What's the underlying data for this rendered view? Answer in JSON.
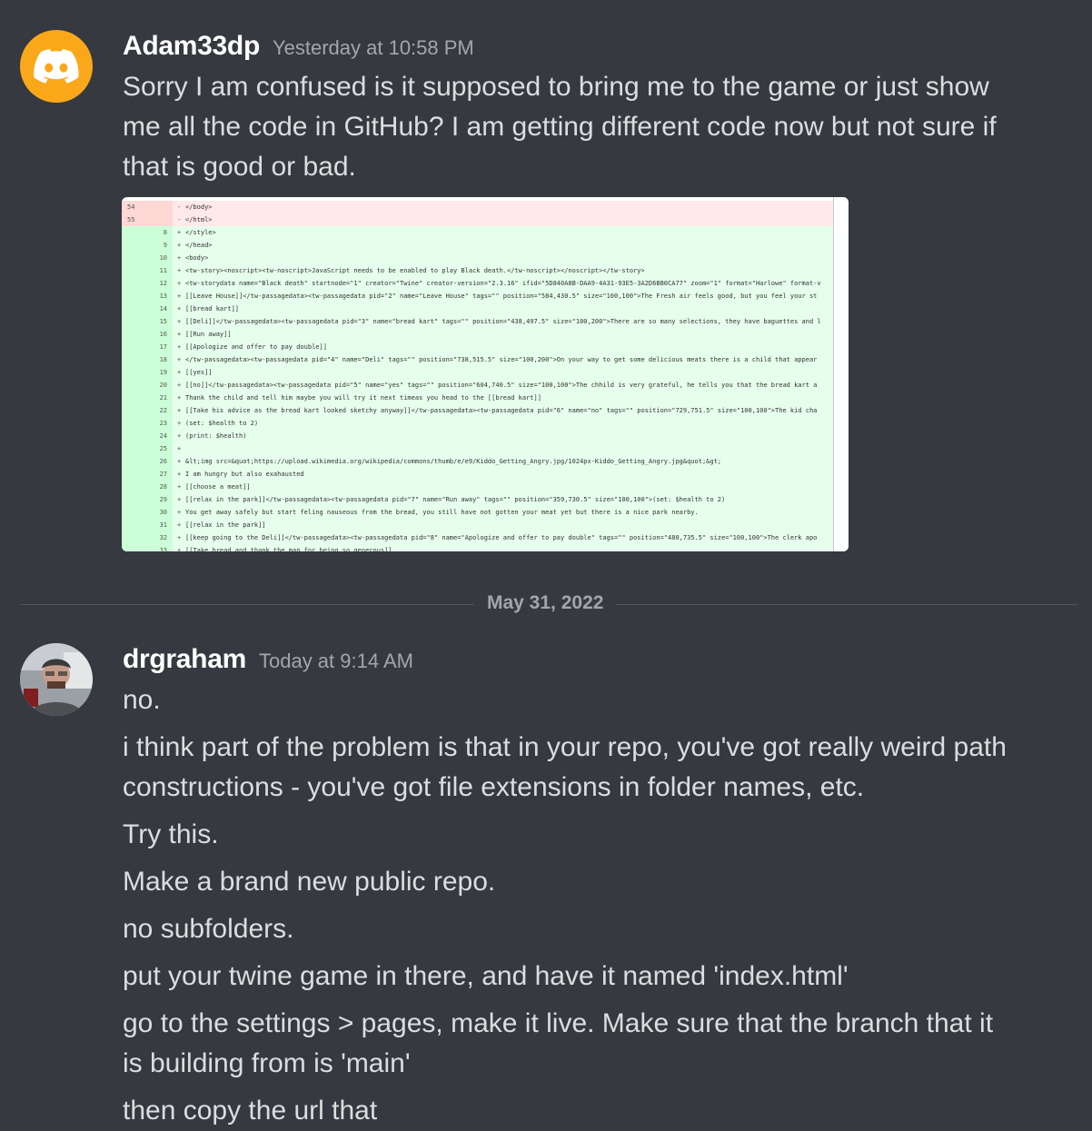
{
  "messages": [
    {
      "author": "Adam33dp",
      "timestamp": "Yesterday at 10:58 PM",
      "lines": [
        "Sorry I am confused is it supposed to bring me to the game or just show",
        "me all the code in GitHub? I am getting different code now but not sure if",
        "that is good or bad."
      ],
      "attachment": {
        "rows": [
          {
            "old": "54",
            "new": "",
            "sign": "-",
            "type": "del",
            "code": "</body>"
          },
          {
            "old": "55",
            "new": "",
            "sign": "-",
            "type": "del",
            "code": "</html>"
          },
          {
            "old": "",
            "new": "8",
            "sign": "+",
            "type": "add",
            "code": "</style>"
          },
          {
            "old": "",
            "new": "9",
            "sign": "+",
            "type": "add",
            "code": "</head>"
          },
          {
            "old": "",
            "new": "10",
            "sign": "+",
            "type": "add",
            "code": "<body>"
          },
          {
            "old": "",
            "new": "11",
            "sign": "+",
            "type": "add",
            "code": "<tw-story><noscript><tw-noscript>JavaScript needs to be enabled to play Black death.</tw-noscript></noscript></tw-story>"
          },
          {
            "old": "",
            "new": "12",
            "sign": "+",
            "type": "add",
            "code": "<tw-storydata name=\"Black death\" startnode=\"1\" creator=\"Twine\" creator-version=\"2.3.16\" ifid=\"5D840A8B-DAA9-4A31-93E5-3A2D6BB0CA77\" zoom=\"1\" format=\"Harlowe\" format-v"
          },
          {
            "old": "",
            "new": "13",
            "sign": "+",
            "type": "add",
            "code": "[[Leave House]]</tw-passagedata><tw-passagedata pid=\"2\" name=\"Leave House\" tags=\"\" position=\"584,430.5\" size=\"100,100\">The Fresh air feels good, but you feel your st"
          },
          {
            "old": "",
            "new": "14",
            "sign": "+",
            "type": "add",
            "code": "[[bread kart]]"
          },
          {
            "old": "",
            "new": "15",
            "sign": "+",
            "type": "add",
            "code": "[[Deli]]</tw-passagedata><tw-passagedata pid=\"3\" name=\"bread kart\" tags=\"\" position=\"438,497.5\" size=\"100,200\">There are so many selections, they have baguettes and l"
          },
          {
            "old": "",
            "new": "16",
            "sign": "+",
            "type": "add",
            "code": "[[Run away]]"
          },
          {
            "old": "",
            "new": "17",
            "sign": "+",
            "type": "add",
            "code": "[[Apologize and offer to pay double]]"
          },
          {
            "old": "",
            "new": "18",
            "sign": "+",
            "type": "add",
            "code": "</tw-passagedata><tw-passagedata pid=\"4\" name=\"Deli\" tags=\"\" position=\"738,515.5\" size=\"100,200\">On your way to get some delicious meats there is a child that appear"
          },
          {
            "old": "",
            "new": "19",
            "sign": "+",
            "type": "add",
            "code": "[[yes]]"
          },
          {
            "old": "",
            "new": "20",
            "sign": "+",
            "type": "add",
            "code": "[[no]]</tw-passagedata><tw-passagedata pid=\"5\" name=\"yes\" tags=\"\" position=\"604,740.5\" size=\"100,100\">The chhild is very grateful, he tells you that the bread kart a"
          },
          {
            "old": "",
            "new": "21",
            "sign": "+",
            "type": "add",
            "code": "Thank the child and tell him maybe you will try it next timeas you head to the [[bread kart]]"
          },
          {
            "old": "",
            "new": "22",
            "sign": "+",
            "type": "add",
            "code": "[[Take his advice as the bread kart looked sketchy anyway]]</tw-passagedata><tw-passagedata pid=\"6\" name=\"no\" tags=\"\" position=\"729,751.5\" size=\"100,100\">The kid cha"
          },
          {
            "old": "",
            "new": "23",
            "sign": "+",
            "type": "add",
            "code": "(set: $health to 2)"
          },
          {
            "old": "",
            "new": "24",
            "sign": "+",
            "type": "add",
            "code": "(print: $health)"
          },
          {
            "old": "",
            "new": "25",
            "sign": "+",
            "type": "add",
            "code": ""
          },
          {
            "old": "",
            "new": "26",
            "sign": "+",
            "type": "add",
            "code": "&lt;img src=&quot;https://upload.wikimedia.org/wikipedia/commons/thumb/e/e9/Kiddo_Getting_Angry.jpg/1024px-Kiddo_Getting_Angry.jpg&quot;&gt;"
          },
          {
            "old": "",
            "new": "27",
            "sign": "+",
            "type": "add",
            "code": "I am hungry but also exahausted"
          },
          {
            "old": "",
            "new": "28",
            "sign": "+",
            "type": "add",
            "code": "[[choose a meat]]"
          },
          {
            "old": "",
            "new": "29",
            "sign": "+",
            "type": "add",
            "code": "[[relax in the park]]</tw-passagedata><tw-passagedata pid=\"7\" name=\"Run away\" tags=\"\" position=\"359,730.5\" size=\"100,100\">(set: $health to 2)"
          },
          {
            "old": "",
            "new": "30",
            "sign": "+",
            "type": "add",
            "code": "You get away safely but start feling nauseous from the bread, you still have not gotten your meat yet but there is a nice park nearby."
          },
          {
            "old": "",
            "new": "31",
            "sign": "+",
            "type": "add",
            "code": "[[relax in the park]]"
          },
          {
            "old": "",
            "new": "32",
            "sign": "+",
            "type": "add",
            "code": "[[keep going to the Deli]]</tw-passagedata><tw-passagedata pid=\"8\" name=\"Apologize and offer to pay double\" tags=\"\" position=\"480,735.5\" size=\"100,100\">The clerk apo"
          },
          {
            "old": "",
            "new": "33",
            "sign": "+",
            "type": "add",
            "code": "[[Take bread and thank the man for being so generous]]"
          }
        ]
      }
    },
    {
      "author": "drgraham",
      "timestamp": "Today at 9:14 AM",
      "lines": [
        "no.",
        "i think part of the problem is that in your repo, you've got really weird path",
        "constructions - you've got file extensions in folder names, etc.",
        "Try this.",
        "Make a brand new public repo.",
        "no subfolders.",
        "put your twine game in there, and have it named 'index.html'",
        "go to the settings > pages, make it live. Make sure that the branch that it",
        "is building from is 'main'",
        "then copy the url that"
      ]
    }
  ],
  "date_divider": "May 31, 2022",
  "colors": {
    "background": "#36393f",
    "discord_avatar": "#faa81a"
  },
  "icons": {
    "avatar1": "discord-logo-icon",
    "avatar2": "user-photo"
  }
}
